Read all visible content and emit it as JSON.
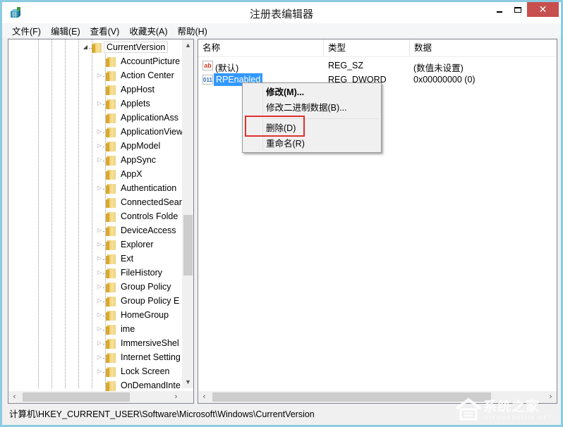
{
  "window": {
    "title": "注册表编辑器",
    "controls": {
      "minimize": "minimize",
      "maximize": "maximize",
      "close": "✕"
    }
  },
  "menubar": [
    {
      "label": "文件(F)"
    },
    {
      "label": "编辑(E)"
    },
    {
      "label": "查看(V)"
    },
    {
      "label": "收藏夹(A)"
    },
    {
      "label": "帮助(H)"
    }
  ],
  "tree": {
    "current": {
      "label": "CurrentVersion",
      "expanded": true
    },
    "children": [
      {
        "label": "AccountPicture",
        "has_children": false
      },
      {
        "label": "Action Center",
        "has_children": true
      },
      {
        "label": "AppHost",
        "has_children": false
      },
      {
        "label": "Applets",
        "has_children": true
      },
      {
        "label": "ApplicationAss",
        "has_children": false
      },
      {
        "label": "ApplicationView",
        "has_children": true
      },
      {
        "label": "AppModel",
        "has_children": true
      },
      {
        "label": "AppSync",
        "has_children": true
      },
      {
        "label": "AppX",
        "has_children": false
      },
      {
        "label": "Authentication",
        "has_children": true
      },
      {
        "label": "ConnectedSear",
        "has_children": false
      },
      {
        "label": "Controls Folde",
        "has_children": false
      },
      {
        "label": "DeviceAccess",
        "has_children": true
      },
      {
        "label": "Explorer",
        "has_children": true
      },
      {
        "label": "Ext",
        "has_children": true
      },
      {
        "label": "FileHistory",
        "has_children": true
      },
      {
        "label": "Group Policy",
        "has_children": true
      },
      {
        "label": "Group Policy E",
        "has_children": true
      },
      {
        "label": "HomeGroup",
        "has_children": true
      },
      {
        "label": "ime",
        "has_children": true
      },
      {
        "label": "ImmersiveShel",
        "has_children": true
      },
      {
        "label": "Internet Setting",
        "has_children": true
      },
      {
        "label": "Lock Screen",
        "has_children": true
      },
      {
        "label": "OnDemandInte",
        "has_children": false
      }
    ]
  },
  "list": {
    "columns": [
      "名称",
      "类型",
      "数据"
    ],
    "rows": [
      {
        "icon": "ab",
        "name": "(默认)",
        "type": "REG_SZ",
        "data": "(数值未设置)",
        "selected": false
      },
      {
        "icon": "011",
        "name": "RPEnabled",
        "type": "REG_DWORD",
        "data": "0x00000000 (0)",
        "selected": true
      }
    ]
  },
  "context_menu": {
    "items": [
      {
        "label": "修改(M)...",
        "bold": true
      },
      {
        "label": "修改二进制数据(B)...",
        "bold": false
      },
      {
        "label": "删除(D)",
        "bold": false,
        "highlighted": true
      },
      {
        "label": "重命名(R)",
        "bold": false
      }
    ],
    "highlight_color": "#e03030"
  },
  "statusbar": {
    "path": "计算机\\HKEY_CURRENT_USER\\Software\\Microsoft\\Windows\\CurrentVersion"
  },
  "watermark": {
    "text": "系统之家",
    "sub": "XITONGZHIJIA.NET"
  },
  "colors": {
    "selection": "#3399ff",
    "close_button": "#c7504f",
    "frame": "#8ccbe0"
  }
}
